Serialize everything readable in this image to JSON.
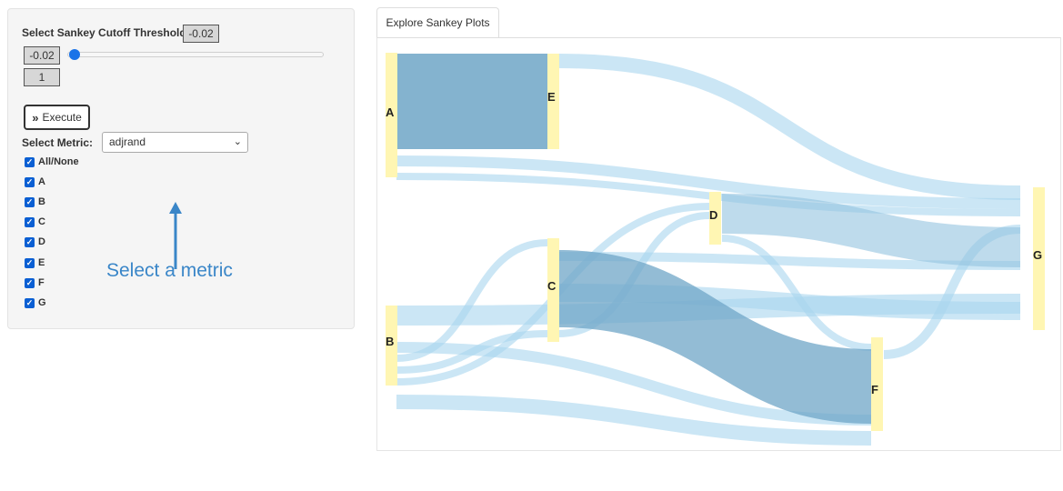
{
  "sidebar": {
    "threshold_label": "Select Sankey Cutoff Threshold:",
    "threshold_value": "-0.02",
    "slider_min": "-0.02",
    "slider_max": "1",
    "execute_label": "Execute",
    "metric_label": "Select Metric:",
    "metric_value": "adjrand",
    "checkboxes": [
      {
        "label": "All/None",
        "checked": true
      },
      {
        "label": "A",
        "checked": true
      },
      {
        "label": "B",
        "checked": true
      },
      {
        "label": "C",
        "checked": true
      },
      {
        "label": "D",
        "checked": true
      },
      {
        "label": "E",
        "checked": true
      },
      {
        "label": "F",
        "checked": true
      },
      {
        "label": "G",
        "checked": true
      }
    ]
  },
  "annotation": {
    "text": "Select a metric"
  },
  "tabs": [
    {
      "label": "Explore Sankey Plots"
    }
  ],
  "sankey": {
    "nodes": [
      "A",
      "B",
      "C",
      "D",
      "E",
      "F",
      "G"
    ],
    "colors": {
      "node": "#fff6b3",
      "link": "#a9d5ef",
      "link_dark": "#6fa6c7"
    }
  }
}
